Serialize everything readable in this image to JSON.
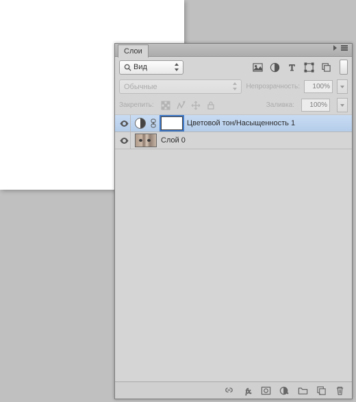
{
  "panel": {
    "title": "Слои",
    "filter": {
      "kind": "Вид"
    },
    "blend_mode": "Обычные",
    "opacity_label": "Непрозрачность:",
    "opacity_value": "100%",
    "fill_label": "Заливка:",
    "fill_value": "100%",
    "lock_label": "Закрепить:"
  },
  "layers": [
    {
      "name": "Цветовой тон/Насыщенность 1",
      "type": "adjustment",
      "visible": true,
      "selected": true
    },
    {
      "name": "Слой 0",
      "type": "pixel",
      "visible": true,
      "selected": false
    }
  ],
  "icons": {
    "filter_image": "image-filter-icon",
    "filter_adjust": "adjustment-filter-icon",
    "filter_text": "type-filter-icon",
    "filter_shape": "shape-filter-icon",
    "filter_smart": "smart-filter-icon"
  }
}
